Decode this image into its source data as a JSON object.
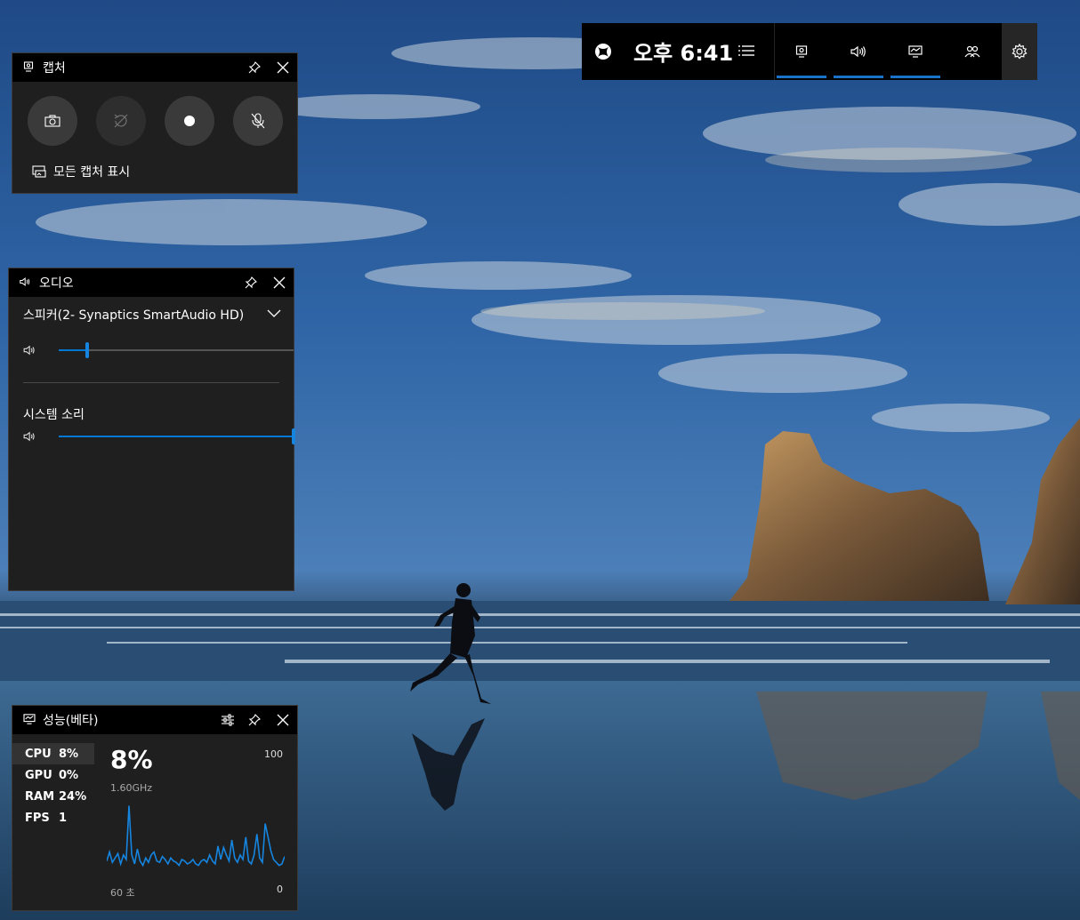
{
  "gamebar": {
    "time": "오후 6:41",
    "sections": [
      "capture-widget-icon",
      "audio-widget-icon",
      "performance-widget-icon",
      "social-widget-icon"
    ],
    "accent": "#1a73c8"
  },
  "capture": {
    "title": "캡처",
    "show_all_label": "모든 캡처 표시",
    "buttons": [
      "screenshot-icon",
      "record-last-icon",
      "record-icon",
      "mic-off-icon"
    ]
  },
  "audio": {
    "title": "오디오",
    "device": "스피커(2- Synaptics SmartAudio HD)",
    "device_volume": 0.12,
    "system_label": "시스템 소리",
    "system_volume": 1.0
  },
  "performance": {
    "title": "성능(베타)",
    "metrics": [
      {
        "name": "CPU",
        "value": "8%"
      },
      {
        "name": "GPU",
        "value": "0%"
      },
      {
        "name": "RAM",
        "value": "24%"
      },
      {
        "name": "FPS",
        "value": "1"
      }
    ],
    "big_value": "8%",
    "frequency": "1.60GHz",
    "max": "100",
    "min": "0",
    "time_window": "60 초",
    "graph_color": "#1685e0",
    "graph_values": [
      8,
      14,
      7,
      10,
      13,
      6,
      12,
      9,
      45,
      12,
      6,
      16,
      8,
      5,
      10,
      7,
      12,
      14,
      8,
      7,
      11,
      9,
      6,
      10,
      8,
      7,
      5,
      9,
      8,
      6,
      7,
      9,
      6,
      5,
      8,
      9,
      7,
      12,
      8,
      6,
      18,
      9,
      17,
      12,
      8,
      22,
      10,
      7,
      12,
      9,
      24,
      8,
      6,
      12,
      26,
      10,
      7,
      33,
      24,
      15,
      9,
      7,
      5,
      6,
      11
    ]
  }
}
